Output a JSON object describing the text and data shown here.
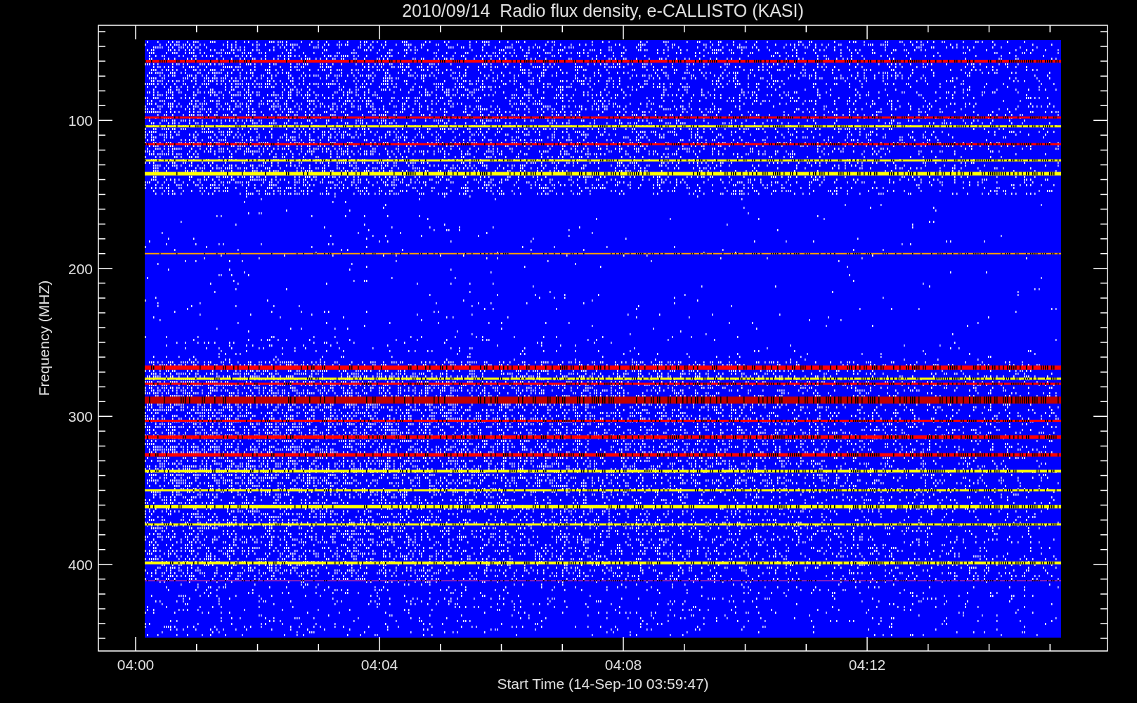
{
  "title": "2010/09/14  Radio flux density, e-CALLISTO (KASI)",
  "y_axis": {
    "label": "Frequency (MHZ)",
    "tick_labels": [
      "100",
      "200",
      "300",
      "400"
    ]
  },
  "x_axis": {
    "label": "Start Time (14-Sep-10 03:59:47)",
    "tick_labels": [
      "04:00",
      "04:04",
      "04:08",
      "04:12"
    ]
  }
}
